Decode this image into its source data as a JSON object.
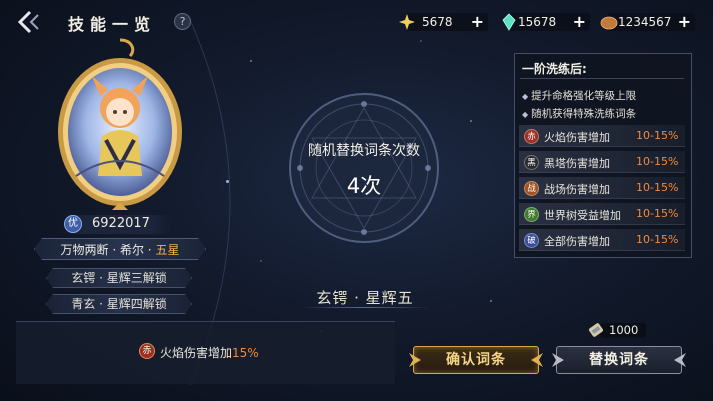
{
  "header": {
    "title": "技能一览",
    "help": "?"
  },
  "currencies": [
    {
      "icon": "star-shard-icon",
      "value": "5678",
      "plus": "+"
    },
    {
      "icon": "crystal-icon",
      "value": "15678",
      "plus": "+"
    },
    {
      "icon": "ore-icon",
      "value": "1234567",
      "plus": "+"
    }
  ],
  "character": {
    "id_badge": "优",
    "id_value": "6922017",
    "name_prefix": "万物两断 · 希尔 · ",
    "rank": "五星",
    "unlocks": [
      "玄锷 · 星辉三解锁",
      "青玄 · 星辉四解锁"
    ]
  },
  "center": {
    "title": "随机替换词条次数",
    "count": "4次",
    "tier": "玄锷 · 星辉五"
  },
  "panel": {
    "title": "一阶洗练后:",
    "bullets": [
      "提升命格强化等级上限",
      "随机获得特殊洗练词条"
    ],
    "options": [
      {
        "badge": "赤",
        "label": "火焰伤害增加",
        "value": "10-15%",
        "color": "#9b2f22"
      },
      {
        "badge": "黑",
        "label": "黑塔伤害增加",
        "value": "10-15%",
        "color": "#2a2a2e"
      },
      {
        "badge": "战",
        "label": "战场伤害增加",
        "value": "10-15%",
        "color": "#a0521f"
      },
      {
        "badge": "界",
        "label": "世界树受益增加",
        "value": "10-15%",
        "color": "#3f7a2e"
      },
      {
        "badge": "破",
        "label": "全部伤害增加",
        "value": "10-15%",
        "color": "#3a4d9a"
      }
    ]
  },
  "effect": {
    "badge": "赤",
    "label": "火焰伤害增加",
    "value": "15%"
  },
  "cost": {
    "value": "1000"
  },
  "buttons": {
    "confirm": "确认词条",
    "replace": "替换词条"
  },
  "colors": {
    "accent_orange": "#f08a3c",
    "gold": "#f0b53e",
    "background": "#121a2c"
  }
}
